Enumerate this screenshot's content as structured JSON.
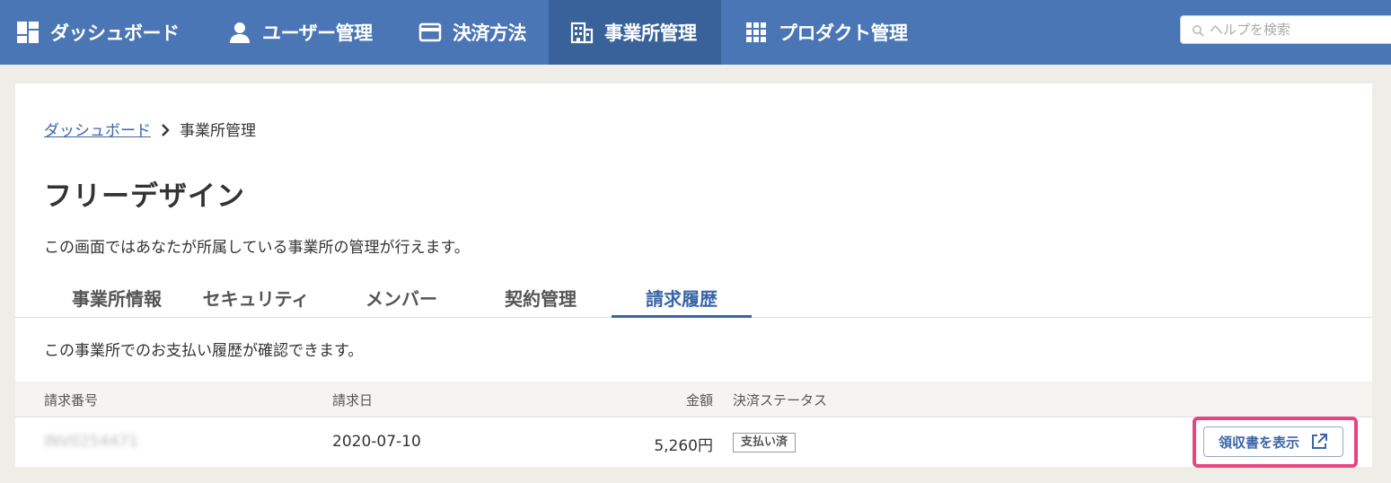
{
  "nav": {
    "items": [
      {
        "label": "ダッシュボード",
        "icon": "dashboard-icon"
      },
      {
        "label": "ユーザー管理",
        "icon": "user-icon"
      },
      {
        "label": "決済方法",
        "icon": "credit-card-icon"
      },
      {
        "label": "事業所管理",
        "icon": "building-icon"
      },
      {
        "label": "プロダクト管理",
        "icon": "grid-icon"
      }
    ],
    "active_index": 3,
    "search_placeholder": "ヘルプを検索"
  },
  "breadcrumb": {
    "parent": "ダッシュボード",
    "current": "事業所管理"
  },
  "page": {
    "title": "フリーデザイン",
    "description": "この画面ではあなたが所属している事業所の管理が行えます。"
  },
  "tabs": [
    {
      "label": "事業所情報"
    },
    {
      "label": "セキュリティ"
    },
    {
      "label": "メンバー"
    },
    {
      "label": "契約管理"
    },
    {
      "label": "請求履歴"
    }
  ],
  "active_tab": 4,
  "billing": {
    "description": "この事業所でのお支払い履歴が確認できます。",
    "columns": {
      "number": "請求番号",
      "date": "請求日",
      "amount": "金額",
      "status": "決済ステータス"
    },
    "rows": [
      {
        "number": "INV0254471",
        "date": "2020-07-10",
        "amount": "5,260円",
        "status": "支払い済",
        "action": "領収書を表示"
      }
    ]
  },
  "colors": {
    "nav_bg": "#4a76b5",
    "nav_active": "#3a629a",
    "accent": "#3a66a8",
    "highlight": "#e8457f"
  }
}
